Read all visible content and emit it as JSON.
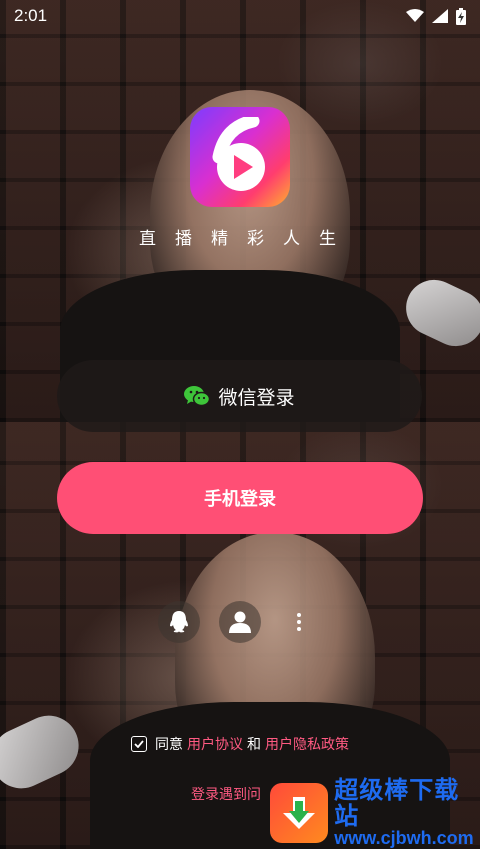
{
  "status_bar": {
    "time": "2:01",
    "icons": [
      "wifi-icon",
      "signal-icon",
      "battery-charging-icon"
    ]
  },
  "brand": {
    "logo_icon": "app-logo-6-play",
    "slogan": "直播精彩人生",
    "colors": {
      "accent": "#ff4f75",
      "link": "#ff5a82"
    }
  },
  "login": {
    "wechat_label": "微信登录",
    "wechat_icon": "wechat-icon",
    "phone_label": "手机登录",
    "alt_options": [
      "qq-icon",
      "user-icon",
      "more-dots-icon"
    ]
  },
  "agreement": {
    "prefix": "同意",
    "user_agreement": "用户协议",
    "conjunction": "和",
    "privacy_policy": "用户隐私政策",
    "checked": true
  },
  "help": {
    "problem_link": "登录遇到问"
  },
  "watermark": {
    "title": "超级棒下载站",
    "url": "www.cjbwh.com"
  }
}
